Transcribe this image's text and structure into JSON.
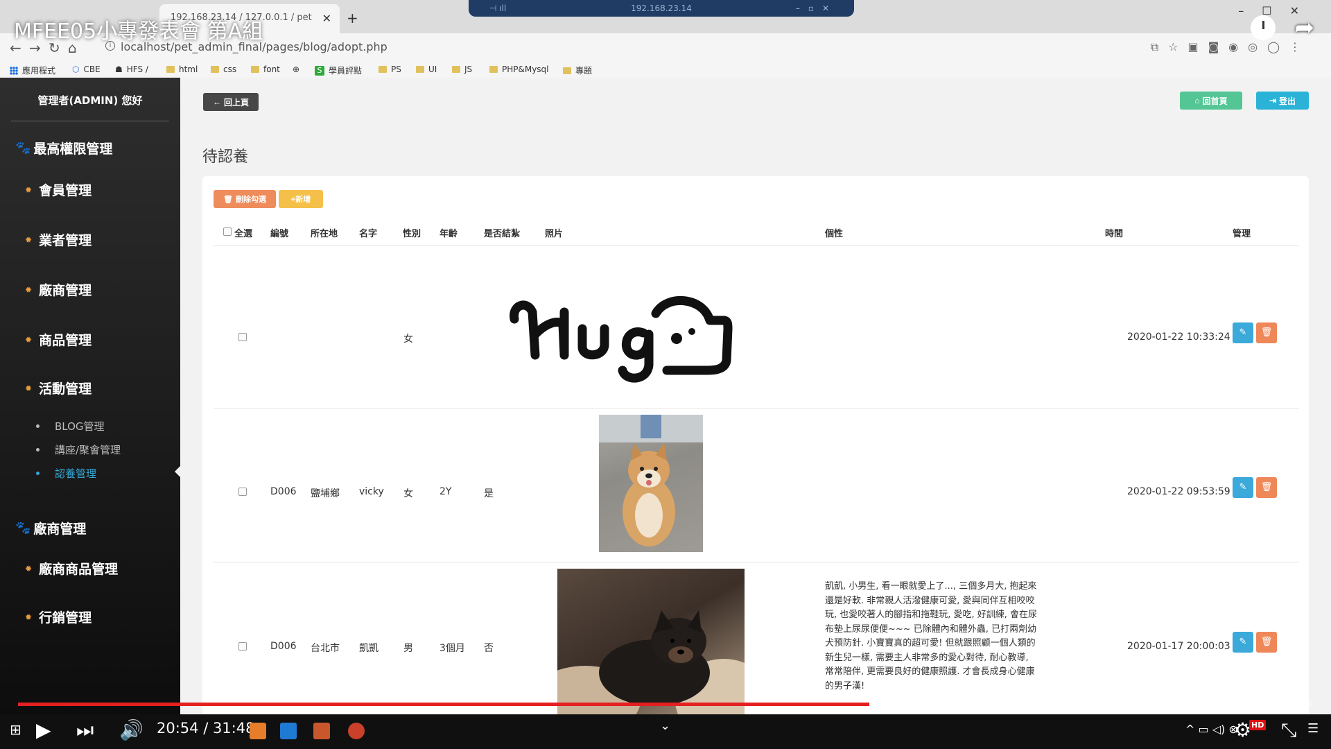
{
  "overlay": {
    "video_title": "MFEE05小專發表會 第A組",
    "share_icon": "share-icon",
    "clock_icon": "watch-later-icon"
  },
  "browser": {
    "tab_title": "192.168.23.14 / 127.0.0.1 / pet",
    "remote_host": "192.168.23.14",
    "url": "localhost/pet_admin_final/pages/blog/adopt.php",
    "bookmarks": [
      "應用程式",
      "CBE",
      "HFS /",
      "html",
      "css",
      "font",
      "學員評點",
      "PS",
      "UI",
      "JS",
      "PHP&Mysql",
      "專題"
    ]
  },
  "sidebar": {
    "greeting": "管理者(ADMIN) 您好",
    "section1": "最高權限管理",
    "items1": [
      "會員管理",
      "業者管理",
      "廠商管理",
      "商品管理",
      "活動管理"
    ],
    "subitems": [
      "BLOG管理",
      "講座/聚會管理",
      "認養管理"
    ],
    "active_sub": "認養管理",
    "section2": "廠商管理",
    "items2": [
      "廠商商品管理",
      "行銷管理"
    ]
  },
  "main": {
    "back_label": "回上頁",
    "home_label": "回首頁",
    "logout_label": "登出",
    "page_title": "待認養",
    "delete_label": "刪除勾選",
    "add_label": "+新增",
    "headers": {
      "select_all": "全選",
      "id": "編號",
      "location": "所在地",
      "name": "名字",
      "gender": "性別",
      "age": "年齡",
      "adopted": "是否結紮",
      "photo": "照片",
      "personality": "個性",
      "time": "時間",
      "manage": "管理"
    },
    "rows": [
      {
        "id": "",
        "location": "",
        "name": "",
        "gender": "女",
        "age": "",
        "adopted": "",
        "photo": "Hugs",
        "personality": "",
        "time": "2020-01-22 10:33:24"
      },
      {
        "id": "D006",
        "location": "鹽埔鄉",
        "name": "vicky",
        "gender": "女",
        "age": "2Y",
        "adopted": "是",
        "photo": "shiba-photo",
        "personality": "",
        "time": "2020-01-22 09:53:59"
      },
      {
        "id": "D006",
        "location": "台北市",
        "name": "凱凱",
        "gender": "男",
        "age": "3個月",
        "adopted": "否",
        "photo": "puppy-photo",
        "personality": "凱凱, 小男生, 看一眼就愛上了..., 三個多月大, 抱起來還是好軟. 非常親人活潑健康可愛, 愛與同伴互相咬咬玩, 也愛咬著人的腳指和拖鞋玩, 愛吃, 好訓練, 會在尿布墊上尿尿便便~~~ 已除體內和體外蟲, 已打兩劑幼犬預防針. 小寶寶真的超可愛! 但就跟照顧一個人類的新生兒一樣, 需要主人非常多的愛心對待, 耐心教導, 常常陪伴, 更需要良好的健康照護. 才會長成身心健康的男子漢!",
        "time": "2020-01-17 20:00:03"
      }
    ]
  },
  "player": {
    "time": "20:54 / 31:48",
    "progress": 0.6576,
    "hd": "HD"
  },
  "colors": {
    "sidebar_active": "#35a9d6",
    "progress": "#e52020",
    "home_btn": "#54c595",
    "logout_btn": "#2ab3d6",
    "delete_btn": "#ef8c5c",
    "add_btn": "#f5c04a"
  }
}
